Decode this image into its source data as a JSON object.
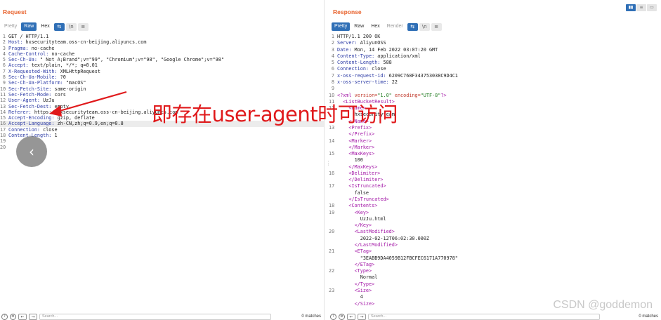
{
  "request": {
    "title": "Request",
    "tabs": [
      "Pretty",
      "Raw",
      "Hex"
    ],
    "icons": [
      "wrap-icon",
      "newline-icon",
      "menu-icon"
    ],
    "icon_glyphs": [
      "⇆",
      "\\n",
      "≡"
    ],
    "lines": [
      {
        "n": "1",
        "name": "",
        "value": "GET / HTTP/1.1"
      },
      {
        "n": "2",
        "name": "Host:",
        "value": " hxsecurityteam.oss-cn-beijing.aliyuncs.com"
      },
      {
        "n": "3",
        "name": "Pragma:",
        "value": " no-cache"
      },
      {
        "n": "4",
        "name": "Cache-Control:",
        "value": " no-cache"
      },
      {
        "n": "5",
        "name": "Sec-Ch-Ua:",
        "value": " \" Not A;Brand\";v=\"99\", \"Chromium\";v=\"98\", \"Google Chrome\";v=\"98\""
      },
      {
        "n": "6",
        "name": "Accept:",
        "value": " text/plain, */*; q=0.01"
      },
      {
        "n": "7",
        "name": "X-Requested-With:",
        "value": " XMLHttpRequest"
      },
      {
        "n": "8",
        "name": "Sec-Ch-Ua-Mobile:",
        "value": " ?0"
      },
      {
        "n": "9",
        "name": "Sec-Ch-Ua-Platform:",
        "value": " \"macOS\""
      },
      {
        "n": "10",
        "name": "Sec-Fetch-Site:",
        "value": " same-origin"
      },
      {
        "n": "11",
        "name": "Sec-Fetch-Mode:",
        "value": " cors"
      },
      {
        "n": "12",
        "name": "User-Agent:",
        "value": " UzJu"
      },
      {
        "n": "13",
        "name": "Sec-Fetch-Dest:",
        "value": " empty"
      },
      {
        "n": "14",
        "name": "Referer:",
        "value": " https://hxsecurityteam.oss-cn-beijing.aliyuncs.com"
      },
      {
        "n": "15",
        "name": "Accept-Encoding:",
        "value": " gzip, deflate"
      },
      {
        "n": "16",
        "name": "Accept-Language:",
        "value": " zh-CN,zh;q=0.9,en;q=0.8"
      },
      {
        "n": "17",
        "name": "Connection:",
        "value": " close"
      },
      {
        "n": "18",
        "name": "Content-Length:",
        "value": " 1"
      },
      {
        "n": "19",
        "name": "",
        "value": ""
      },
      {
        "n": "20",
        "name": "",
        "value": ""
      }
    ],
    "search_placeholder": "Search...",
    "matches": "0 matches"
  },
  "response": {
    "title": "Response",
    "tabs": [
      "Pretty",
      "Raw",
      "Hex",
      "Render"
    ],
    "header_lines": [
      {
        "n": "1",
        "name": "",
        "value": "HTTP/1.1 200 OK"
      },
      {
        "n": "2",
        "name": "Server:",
        "value": " AliyunOSS"
      },
      {
        "n": "3",
        "name": "Date:",
        "value": " Mon, 14 Feb 2022 03:07:20 GMT"
      },
      {
        "n": "4",
        "name": "Content-Type:",
        "value": " application/xml"
      },
      {
        "n": "5",
        "name": "Content-Length:",
        "value": " 588"
      },
      {
        "n": "6",
        "name": "Connection:",
        "value": " close"
      },
      {
        "n": "7",
        "name": "x-oss-request-id:",
        "value": " 6209C768F343753038C9D4C1"
      },
      {
        "n": "8",
        "name": "x-oss-server-time:",
        "value": " 22"
      },
      {
        "n": "9",
        "name": "",
        "value": ""
      }
    ],
    "xml_decl": {
      "n": "10",
      "open": "<?xml ",
      "attr1": "version=",
      "val1": "\"1.0\"",
      "sp": " ",
      "attr2": "encoding=",
      "val2": "\"UTF-8\"",
      "close": "?>"
    },
    "xml_lines": [
      {
        "n": "11",
        "indent": "  ",
        "tag": "<ListBucketResult>",
        "text": ""
      },
      {
        "n": "12",
        "indent": "    ",
        "tag": "<Name>",
        "text": ""
      },
      {
        "n": "",
        "indent": "      ",
        "tag": "",
        "text": "hxsecurityteam"
      },
      {
        "n": "",
        "indent": "    ",
        "tag": "</Name>",
        "text": ""
      },
      {
        "n": "13",
        "indent": "    ",
        "tag": "<Prefix>",
        "text": ""
      },
      {
        "n": "",
        "indent": "    ",
        "tag": "</Prefix>",
        "text": ""
      },
      {
        "n": "14",
        "indent": "    ",
        "tag": "<Marker>",
        "text": ""
      },
      {
        "n": "",
        "indent": "    ",
        "tag": "</Marker>",
        "text": ""
      },
      {
        "n": "15",
        "indent": "    ",
        "tag": "<MaxKeys>",
        "text": ""
      },
      {
        "n": "",
        "indent": "      ",
        "tag": "",
        "text": "100"
      },
      {
        "n": "",
        "indent": "    ",
        "tag": "</MaxKeys>",
        "text": ""
      },
      {
        "n": "16",
        "indent": "    ",
        "tag": "<Delimiter>",
        "text": ""
      },
      {
        "n": "",
        "indent": "    ",
        "tag": "</Delimiter>",
        "text": ""
      },
      {
        "n": "17",
        "indent": "    ",
        "tag": "<IsTruncated>",
        "text": ""
      },
      {
        "n": "",
        "indent": "      ",
        "tag": "",
        "text": "false"
      },
      {
        "n": "",
        "indent": "    ",
        "tag": "</IsTruncated>",
        "text": ""
      },
      {
        "n": "18",
        "indent": "    ",
        "tag": "<Contents>",
        "text": ""
      },
      {
        "n": "19",
        "indent": "      ",
        "tag": "<Key>",
        "text": ""
      },
      {
        "n": "",
        "indent": "        ",
        "tag": "",
        "text": "UzJu.html"
      },
      {
        "n": "",
        "indent": "      ",
        "tag": "</Key>",
        "text": ""
      },
      {
        "n": "20",
        "indent": "      ",
        "tag": "<LastModified>",
        "text": ""
      },
      {
        "n": "",
        "indent": "        ",
        "tag": "",
        "text": "2022-02-12T06:02:30.000Z"
      },
      {
        "n": "",
        "indent": "      ",
        "tag": "</LastModified>",
        "text": ""
      },
      {
        "n": "21",
        "indent": "      ",
        "tag": "<ETag>",
        "text": ""
      },
      {
        "n": "",
        "indent": "        ",
        "tag": "",
        "text": "\"3EABB9DA4059B12FBCFEC6171A770978\""
      },
      {
        "n": "",
        "indent": "      ",
        "tag": "</ETag>",
        "text": ""
      },
      {
        "n": "22",
        "indent": "      ",
        "tag": "<Type>",
        "text": ""
      },
      {
        "n": "",
        "indent": "        ",
        "tag": "",
        "text": "Normal"
      },
      {
        "n": "",
        "indent": "      ",
        "tag": "</Type>",
        "text": ""
      },
      {
        "n": "23",
        "indent": "      ",
        "tag": "<Size>",
        "text": ""
      },
      {
        "n": "",
        "indent": "        ",
        "tag": "",
        "text": "4"
      },
      {
        "n": "",
        "indent": "      ",
        "tag": "</Size>",
        "text": ""
      }
    ],
    "search_placeholder": "Search...",
    "matches": "0 matches"
  },
  "view_toggle": [
    "▮▮",
    "≡",
    "▭"
  ],
  "annotation": "即存在user-agent时可访问",
  "back_glyph": "‹",
  "watermark": "CSDN @goddemon",
  "colors": {
    "accent": "#2f6fb6",
    "title": "#e8622c",
    "annotation": "#e0191b"
  }
}
